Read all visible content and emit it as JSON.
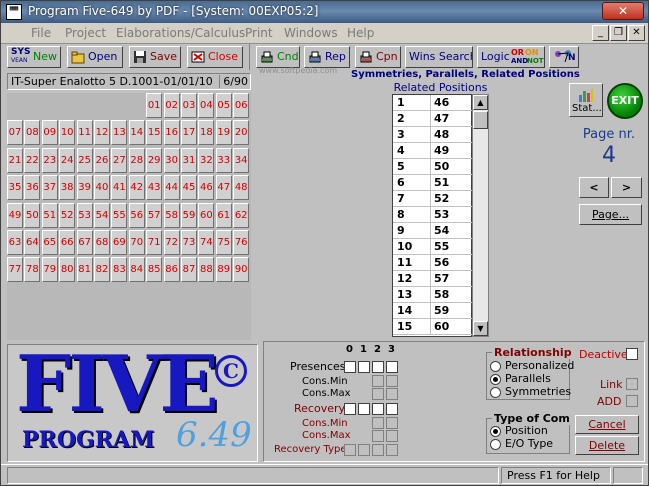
{
  "window": {
    "title": "Program Five-649 by PDF - [System: 00EXP05:2]",
    "app_icon_text": "▦▦"
  },
  "menu": [
    "File",
    "Project",
    "Elaborations/Calculus",
    "Print",
    "Windows",
    "Help"
  ],
  "toolbar": {
    "sys_top": "SYS",
    "sys_bottom": "VEAN",
    "new": "New",
    "open": "Open",
    "save": "Save",
    "close": "Close",
    "cnd": "Cnd",
    "rep": "Rep",
    "cpn": "Cpn",
    "wins_search": "Wins Search",
    "logic": "Logic",
    "logic_badge_or": "OR",
    "logic_badge_on": "ON",
    "logic_badge_and": "AND",
    "logic_badge_not": "NOT",
    "last_badge": "N",
    "watermark": "www.softpedia.com"
  },
  "lottery": {
    "label": "IT-Super Enalotto 5 D.1001-01/01/10",
    "count": "6/90",
    "numbers": [
      "01",
      "02",
      "03",
      "04",
      "05",
      "06",
      "07",
      "08",
      "09",
      "10",
      "11",
      "12",
      "13",
      "14",
      "15",
      "16",
      "17",
      "18",
      "19",
      "20",
      "21",
      "22",
      "23",
      "24",
      "25",
      "26",
      "27",
      "28",
      "29",
      "30",
      "31",
      "32",
      "33",
      "34",
      "35",
      "36",
      "37",
      "38",
      "39",
      "40",
      "41",
      "42",
      "43",
      "44",
      "45",
      "46",
      "47",
      "48",
      "49",
      "50",
      "51",
      "52",
      "53",
      "54",
      "55",
      "56",
      "57",
      "58",
      "59",
      "60",
      "61",
      "62",
      "63",
      "64",
      "65",
      "66",
      "67",
      "68",
      "69",
      "70",
      "71",
      "72",
      "73",
      "74",
      "75",
      "76",
      "77",
      "78",
      "79",
      "80",
      "81",
      "82",
      "83",
      "84",
      "85",
      "86",
      "87",
      "88",
      "89",
      "90"
    ]
  },
  "logo": {
    "main": "FIVE",
    "copyright": "C",
    "program": "PROGRAM",
    "version": "6.49"
  },
  "symmetries": {
    "title": "Symmetries, Parallels, Related Positions",
    "list_header": "Related Positions",
    "rows": [
      [
        "1",
        "46"
      ],
      [
        "2",
        "47"
      ],
      [
        "3",
        "48"
      ],
      [
        "4",
        "49"
      ],
      [
        "5",
        "50"
      ],
      [
        "6",
        "51"
      ],
      [
        "7",
        "52"
      ],
      [
        "8",
        "53"
      ],
      [
        "9",
        "54"
      ],
      [
        "10",
        "55"
      ],
      [
        "11",
        "56"
      ],
      [
        "12",
        "57"
      ],
      [
        "13",
        "58"
      ],
      [
        "14",
        "59"
      ],
      [
        "15",
        "60"
      ]
    ],
    "scroll_up": "▲",
    "scroll_down": "▼"
  },
  "right_panel": {
    "stat_label": "Stat...",
    "exit_label": "EXIT",
    "page_label": "Page nr.",
    "page_number": "4",
    "prev": "<",
    "next": ">",
    "page_button": "Page..."
  },
  "lower": {
    "col_headers": [
      "0",
      "1",
      "2",
      "3"
    ],
    "presences": "Presences",
    "cons_min": "Cons.Min",
    "cons_max": "Cons.Max",
    "recovery": "Recovery",
    "cons_min2": "Cons.Min",
    "cons_max2": "Cons.Max",
    "recovery_type": "Recovery Type",
    "relationship_title": "Relationship",
    "rel_options": [
      "Personalized",
      "Parallels",
      "Symmetries"
    ],
    "rel_selected": 1,
    "type_title": "Type of Com",
    "type_options": [
      "Position",
      "E/O Type"
    ],
    "type_selected": 0,
    "deactive": "Deactive",
    "link": "Link",
    "add": "ADD",
    "cancel": "Cancel",
    "delete": "Delete"
  },
  "status": {
    "help": "Press F1 for Help"
  },
  "colors": {
    "number_red": "#d00000",
    "logo_blue": "#1818c0",
    "page_blue": "#1a3a8a"
  }
}
